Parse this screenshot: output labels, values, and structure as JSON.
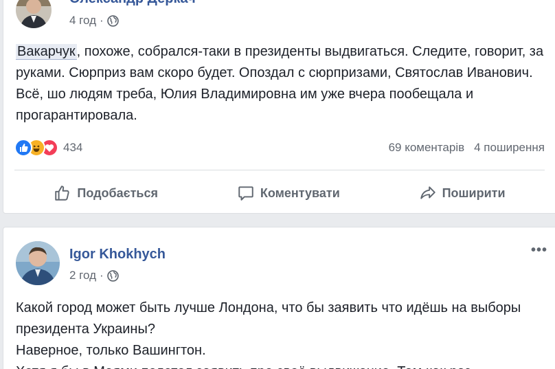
{
  "post1": {
    "author": "Олександр Деркач",
    "time": "4 год",
    "separator": "·",
    "mention": "Вакарчук",
    "body": ", похоже, собрался-таки в президенты выдвигаться. Следите, говорит, за руками. Сюрприз вам скоро будет. Опоздал с сюрпризами, Святослав Иванович. Всё, шо людям треба, Юлия Владимировна им уже вчера пообещала и прогарантировала.",
    "reactions_count": "434",
    "reactions_icons": [
      "like-reaction-icon",
      "haha-reaction-icon",
      "love-reaction-icon"
    ],
    "comments": "69 коментарів",
    "shares": "4 поширення",
    "actions": {
      "like": "Подобається",
      "comment": "Коментувати",
      "share": "Поширити"
    }
  },
  "post2": {
    "author": "Igor Khokhych",
    "time": "2 год",
    "separator": "·",
    "more": "•••",
    "body_lines": [
      "Какой город может быть лучше Лондона, что бы заявить что идёшь на выборы президента Украины?",
      "Наверное, только Вашингтон.",
      "Хотя я бы в Маями полетел заявить про своё выдвижение. Там как раз"
    ]
  },
  "colors": {
    "link": "#365899",
    "text": "#1d2129",
    "muted": "#616770",
    "like": "#2078f4",
    "love": "#f33e58",
    "haha": "#f7b125"
  }
}
